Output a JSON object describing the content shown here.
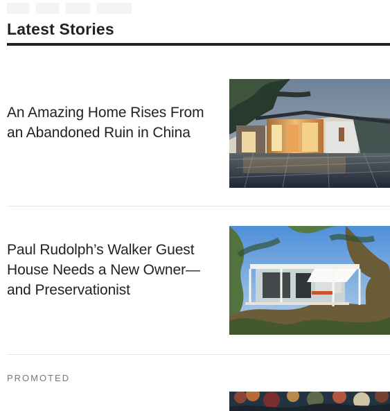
{
  "section": {
    "title": "Latest Stories"
  },
  "stories": [
    {
      "headline": "An Amazing Home Rises From an Abandoned Ruin in China",
      "image_icon": "house-ruin-china-photo"
    },
    {
      "headline": "Paul Rudolph’s Walker Guest House Needs a New Owner—and Preservationist",
      "image_icon": "walker-guest-house-photo"
    }
  ],
  "promoted": {
    "label": "PROMOTED",
    "image_icon": "promoted-story-photo"
  }
}
